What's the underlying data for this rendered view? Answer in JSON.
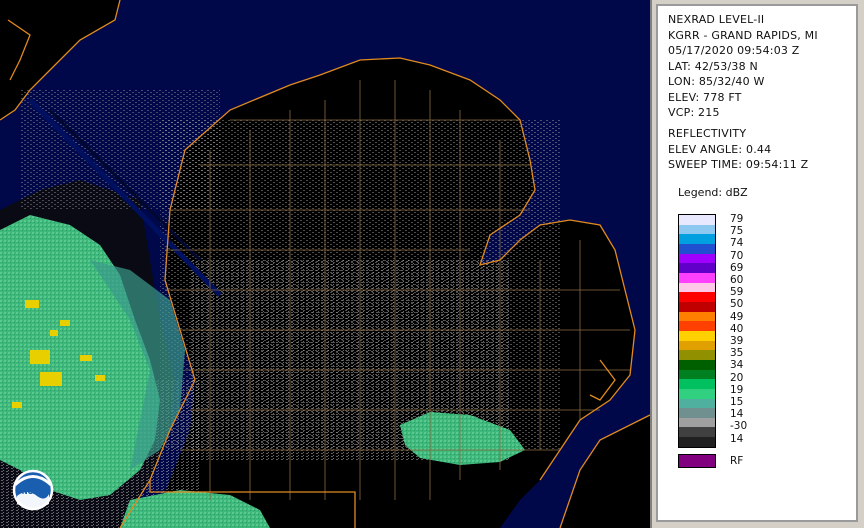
{
  "station_info": {
    "product": "NEXRAD LEVEL-II",
    "site": "KGRR - GRAND RAPIDS, MI",
    "datetime": "05/17/2020 09:54:03 Z",
    "lat": "LAT: 42/53/38 N",
    "lon": "LON: 85/32/40 W",
    "elev": "ELEV: 778 FT",
    "vcp": "VCP: 215"
  },
  "product_info": {
    "name": "REFLECTIVITY",
    "elev_angle": "ELEV ANGLE: 0.44",
    "sweep_time": "SWEEP TIME: 09:54:11 Z"
  },
  "legend": {
    "title": "Legend: dBZ",
    "labels": [
      "79",
      "75",
      "74",
      "70",
      "69",
      "60",
      "59",
      "50",
      "49",
      "40",
      "39",
      "35",
      "34",
      "20",
      "19",
      "15",
      "14",
      "-30",
      "14"
    ],
    "colors": [
      "#e8e8ff",
      "#8cc8f0",
      "#00a0e0",
      "#2050d0",
      "#a000ff",
      "#6000c8",
      "#ff40ff",
      "#ffc8e8",
      "#ff0000",
      "#c00000",
      "#ff8000",
      "#ff4000",
      "#ffd000",
      "#e0a000",
      "#909000",
      "#006000",
      "#008020",
      "#00c060",
      "#30d080",
      "#50b0a0",
      "#709090",
      "#a0a0a0",
      "#404040",
      "#202020"
    ],
    "rf_label": "RF",
    "rf_color": "#800080"
  },
  "map": {
    "background_color": "#000010",
    "water_color": "#00084a",
    "coastline_color": "#e08a20",
    "county_color": "#8a6a40",
    "logo_text": "NOAA"
  }
}
